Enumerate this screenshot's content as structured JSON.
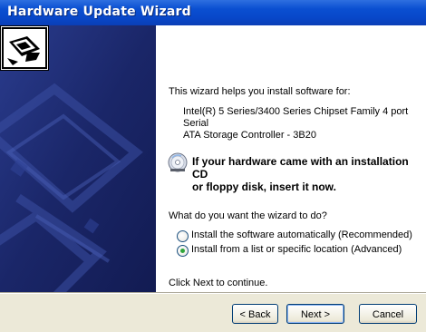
{
  "window": {
    "title": "Hardware Update Wizard"
  },
  "content": {
    "intro": "This wizard helps you install software for:",
    "device_line1": "Intel(R) 5 Series/3400 Series Chipset Family 4 port Serial",
    "device_line2": "ATA Storage Controller - 3B20",
    "cd_line1": "If your hardware came with an installation CD",
    "cd_line2": "or floppy disk, insert it now.",
    "question": "What do you want the wizard to do?",
    "options": [
      {
        "label": "Install the software automatically (Recommended)",
        "selected": false
      },
      {
        "label": "Install from a list or specific location (Advanced)",
        "selected": true
      }
    ],
    "next_hint": "Click Next to continue."
  },
  "buttons": {
    "back": "< Back",
    "next": "Next >",
    "cancel": "Cancel"
  },
  "icons": {
    "wizard": "hardware-wizard-icon",
    "cd": "cd-disk-icon"
  },
  "colors": {
    "titlebar": "#0a4fd1",
    "left_panel": "#1c2a72",
    "footer": "#ece9d8",
    "radio_selected": "#2fa53a"
  }
}
